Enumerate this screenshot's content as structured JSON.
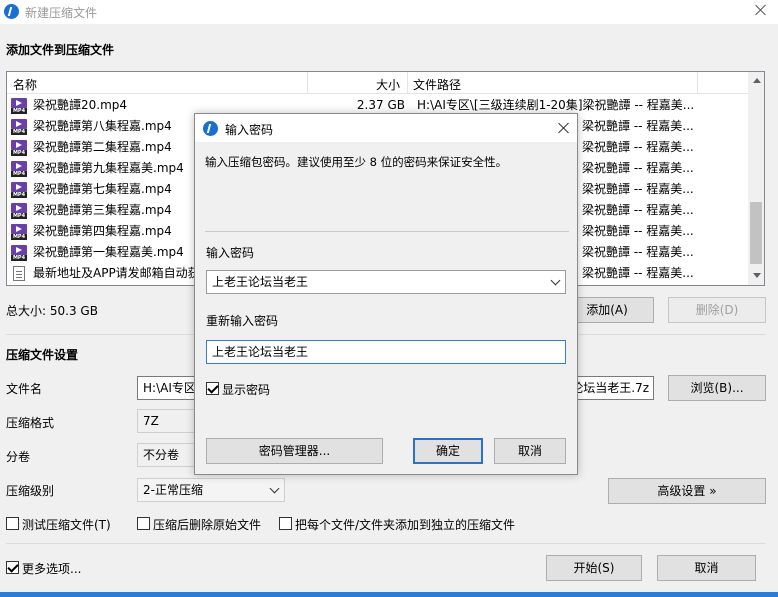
{
  "window": {
    "title": "新建压缩文件"
  },
  "section_add": {
    "title": "添加文件到压缩文件"
  },
  "file_list": {
    "columns": {
      "name": "名称",
      "size": "大小",
      "path": "文件路径"
    },
    "first_row": {
      "name": "梁祝艷譚20.mp4",
      "size": "2.37 GB",
      "path": "H:\\AI专区\\[三级连续剧1-20集]梁祝艷譚 -- 程嘉美..."
    },
    "rows": [
      {
        "name": "梁祝艷譚第八集程嘉.mp4",
        "path": "梁祝艷譚 -- 程嘉美..."
      },
      {
        "name": "梁祝艷譚第二集程嘉.mp4",
        "path": "梁祝艷譚 -- 程嘉美..."
      },
      {
        "name": "梁祝艷譚第九集程嘉美.mp4",
        "path": "梁祝艷譚 -- 程嘉美..."
      },
      {
        "name": "梁祝艷譚第七集程嘉.mp4",
        "path": "梁祝艷譚 -- 程嘉美..."
      },
      {
        "name": "梁祝艷譚第三集程嘉.mp4",
        "path": "梁祝艷譚 -- 程嘉美..."
      },
      {
        "name": "梁祝艷譚第四集程嘉.mp4",
        "path": "梁祝艷譚 -- 程嘉美..."
      },
      {
        "name": "梁祝艷譚第一集程嘉美.mp4",
        "path": "梁祝艷譚 -- 程嘉美..."
      },
      {
        "name": "最新地址及APP请发邮箱自动获",
        "path": "梁祝艷譚 -- 程嘉美..."
      }
    ]
  },
  "total_size": "总大小: 50.3 GB",
  "buttons": {
    "add": "添加(A)",
    "delete": "删除(D)",
    "browse": "浏览(B)...",
    "advanced": "高级设置 »",
    "start": "开始(S)",
    "cancel": "取消"
  },
  "settings": {
    "title": "压缩文件设置",
    "filename_label": "文件名",
    "filename_value": "H:\\AI专区",
    "filename_tail": "论坛当老王.7z",
    "format_label": "压缩格式",
    "format_value": "7Z",
    "split_label": "分卷",
    "split_value": "不分卷",
    "level_label": "压缩级别",
    "level_value": "2-正常压缩"
  },
  "options": {
    "test": "测试压缩文件(T)",
    "delete_after": "压缩后删除原始文件",
    "separate": "把每个文件/文件夹添加到独立的压缩文件",
    "more": "更多选项..."
  },
  "dialog": {
    "title": "输入密码",
    "hint": "输入压缩包密码。建议使用至少 8 位的密码来保证安全性。",
    "enter_label": "输入密码",
    "enter_value": "上老王论坛当老王",
    "reenter_label": "重新输入密码",
    "reenter_value": "上老王论坛当老王",
    "show_password": "显示密码",
    "manager_button": "密码管理器...",
    "ok_button": "确定",
    "cancel_button": "取消"
  }
}
